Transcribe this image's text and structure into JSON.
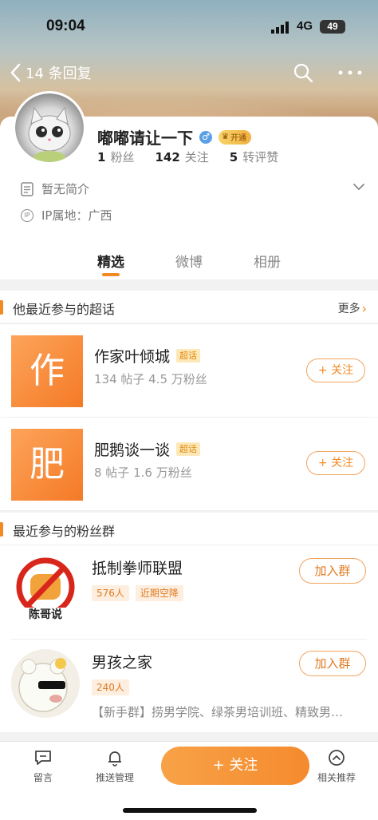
{
  "status": {
    "time": "09:04",
    "network": "4G",
    "battery": "49"
  },
  "nav": {
    "back_label": "14 条回复"
  },
  "profile": {
    "name": "嘟嘟请让一下",
    "gender_symbol": "♂",
    "vip_label": "开通",
    "fans_count": "1",
    "fans_label": "粉丝",
    "following_count": "142",
    "following_label": "关注",
    "likes_count": "5",
    "likes_label": "转评赞",
    "bio": "暂无简介",
    "ip_icon_text": "IP",
    "ip_location": "IP属地：广西"
  },
  "tabs": [
    {
      "label": "精选",
      "active": true
    },
    {
      "label": "微博",
      "active": false
    },
    {
      "label": "相册",
      "active": false
    }
  ],
  "super_topics": {
    "title": "他最近参与的超话",
    "more_label": "更多",
    "items": [
      {
        "tile_char": "作",
        "name": "作家叶倾城",
        "tag": "超话",
        "stats": "134 帖子  4.5 万粉丝",
        "button": "+ 关注"
      },
      {
        "tile_char": "肥",
        "name": "肥鹅谈一谈",
        "tag": "超话",
        "stats": "8 帖子  1.6 万粉丝",
        "button": "+ 关注"
      }
    ]
  },
  "fan_groups": {
    "title": "最近参与的粉丝群",
    "items": [
      {
        "name": "抵制拳师联盟",
        "tags": [
          "576人",
          "近期空降"
        ],
        "desc": "",
        "button": "加入群",
        "avatar_text": "陈哥说"
      },
      {
        "name": "男孩之家",
        "tags": [
          "240人"
        ],
        "desc": "【新手群】捞男学院、绿茶男培训班、精致男…",
        "button": "加入群",
        "avatar_text": ""
      }
    ]
  },
  "bottom_bar": {
    "comment_label": "留言",
    "push_label": "推送管理",
    "follow_label": "+ 关注",
    "related_label": "相关推荐"
  },
  "colors": {
    "accent": "#f28a23",
    "tile_orange": "#f47a26",
    "gender_blue": "#5aa0e8"
  }
}
